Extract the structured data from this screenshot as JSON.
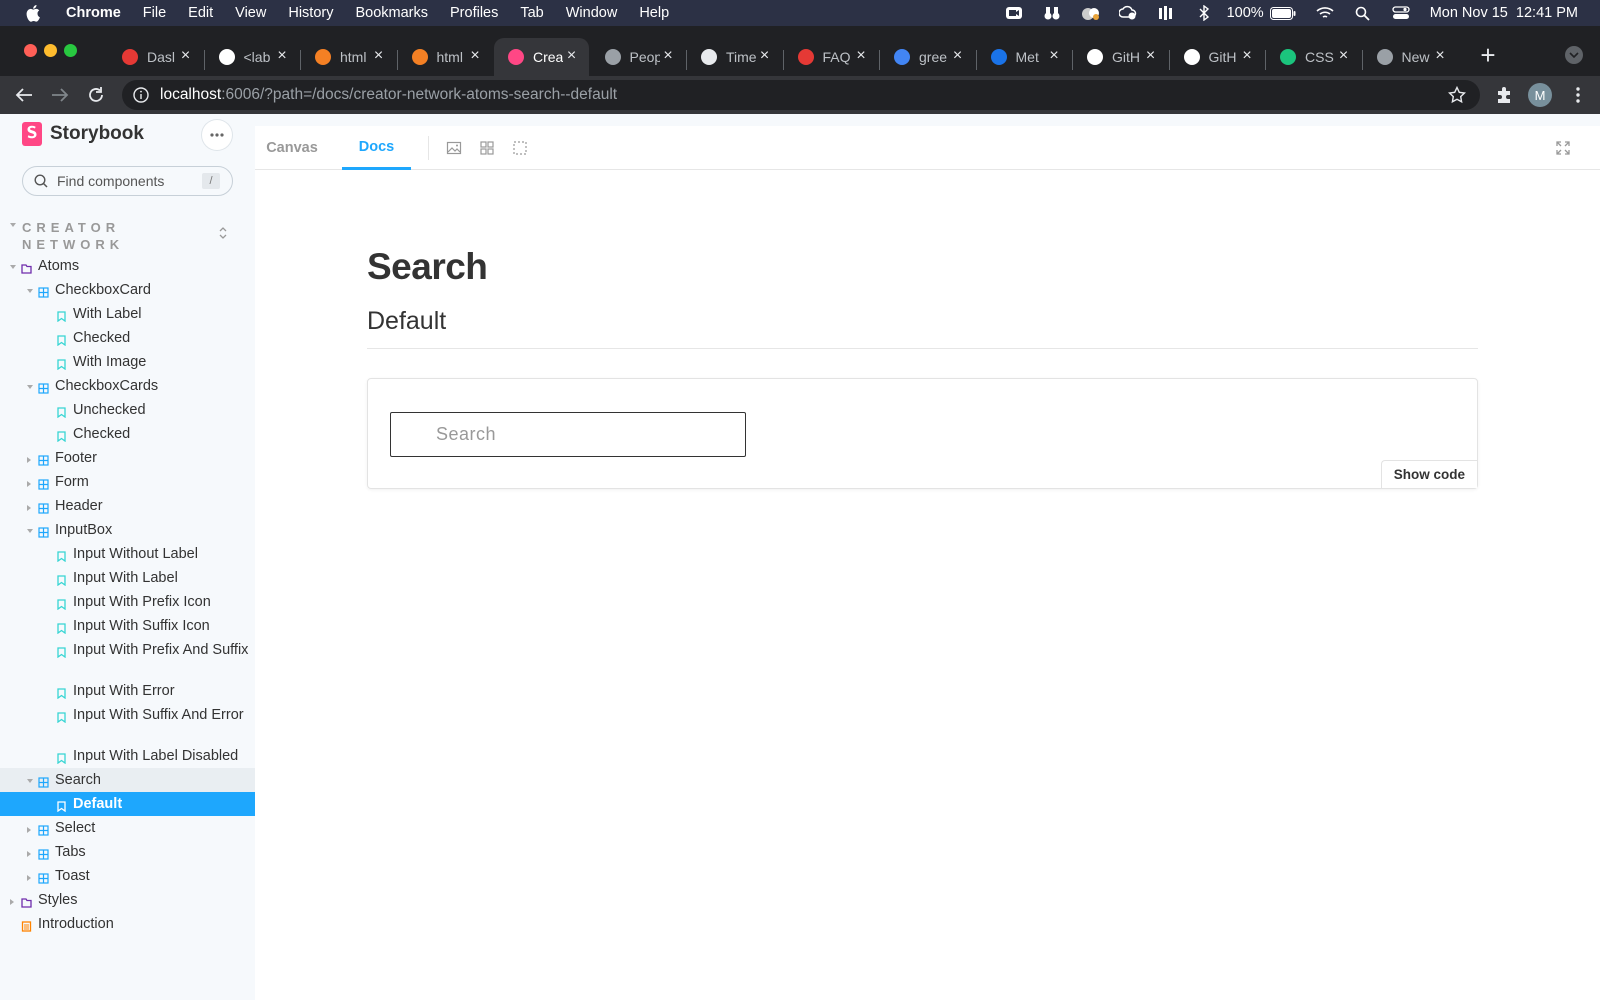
{
  "menubar": {
    "app": "Chrome",
    "items": [
      "File",
      "Edit",
      "View",
      "History",
      "Bookmarks",
      "Profiles",
      "Tab",
      "Window",
      "Help"
    ],
    "battery": "100%",
    "datetime": "Mon Nov 15  12:41 PM"
  },
  "browser": {
    "tabs": [
      {
        "title": "Dasl",
        "favicon_color": "#e53935"
      },
      {
        "title": "<lab",
        "favicon_color": "#ffffff"
      },
      {
        "title": "html",
        "favicon_color": "#f48024"
      },
      {
        "title": "html",
        "favicon_color": "#f48024"
      },
      {
        "title": "Crea",
        "favicon_color": "#ff4785"
      },
      {
        "title": "Peop",
        "favicon_color": "#9aa0a6"
      },
      {
        "title": "Time",
        "favicon_color": "#e8eaed"
      },
      {
        "title": "FAQ",
        "favicon_color": "#e53935"
      },
      {
        "title": "gree",
        "favicon_color": "#4285f4"
      },
      {
        "title": "Met",
        "favicon_color": "#1a73e8"
      },
      {
        "title": "GitH",
        "favicon_color": "#ffffff"
      },
      {
        "title": "GitH",
        "favicon_color": "#ffffff"
      },
      {
        "title": "CSS",
        "favicon_color": "#1bc47d"
      },
      {
        "title": "New",
        "favicon_color": "#9aa0a6"
      }
    ],
    "active_tab_index": 4,
    "url_host": "localhost",
    "url_rest": ":6006/?path=/docs/creator-network-atoms-search--default",
    "avatar_initial": "M"
  },
  "sidebar": {
    "brand": "Storybook",
    "search_placeholder": "Find components",
    "search_shortcut": "/",
    "group": "CREATOR NETWORK",
    "tree": [
      {
        "label": "Atoms",
        "level": 0,
        "kind": "folder",
        "caret": "down"
      },
      {
        "label": "CheckboxCard",
        "level": 1,
        "kind": "component",
        "caret": "down"
      },
      {
        "label": "With Label",
        "level": 2,
        "kind": "story"
      },
      {
        "label": "Checked",
        "level": 2,
        "kind": "story"
      },
      {
        "label": "With Image",
        "level": 2,
        "kind": "story"
      },
      {
        "label": "CheckboxCards",
        "level": 1,
        "kind": "component",
        "caret": "down"
      },
      {
        "label": "Unchecked",
        "level": 2,
        "kind": "story"
      },
      {
        "label": "Checked",
        "level": 2,
        "kind": "story"
      },
      {
        "label": "Footer",
        "level": 1,
        "kind": "component",
        "caret": "right"
      },
      {
        "label": "Form",
        "level": 1,
        "kind": "component",
        "caret": "right"
      },
      {
        "label": "Header",
        "level": 1,
        "kind": "component",
        "caret": "right"
      },
      {
        "label": "InputBox",
        "level": 1,
        "kind": "component",
        "caret": "down"
      },
      {
        "label": "Input Without Label",
        "level": 2,
        "kind": "story"
      },
      {
        "label": "Input With Label",
        "level": 2,
        "kind": "story"
      },
      {
        "label": "Input With Prefix Icon",
        "level": 2,
        "kind": "story"
      },
      {
        "label": "Input With Suffix Icon",
        "level": 2,
        "kind": "story"
      },
      {
        "label": "Input With Prefix And Suffix",
        "level": 2,
        "kind": "story",
        "lines": 2
      },
      {
        "label": "Input With Error",
        "level": 2,
        "kind": "story"
      },
      {
        "label": "Input With Suffix And Error",
        "level": 2,
        "kind": "story",
        "lines": 2
      },
      {
        "label": "Input With Label Disabled",
        "level": 2,
        "kind": "story"
      },
      {
        "label": "Search",
        "level": 1,
        "kind": "component",
        "caret": "down",
        "highlight": true
      },
      {
        "label": "Default",
        "level": 2,
        "kind": "story",
        "selected": true
      },
      {
        "label": "Select",
        "level": 1,
        "kind": "component",
        "caret": "right"
      },
      {
        "label": "Tabs",
        "level": 1,
        "kind": "component",
        "caret": "right"
      },
      {
        "label": "Toast",
        "level": 1,
        "kind": "component",
        "caret": "right"
      },
      {
        "label": "Styles",
        "level": 0,
        "kind": "folder",
        "caret": "right"
      },
      {
        "label": "Introduction",
        "level": 0,
        "kind": "doc"
      }
    ]
  },
  "main": {
    "tabs": [
      "Canvas",
      "Docs"
    ],
    "active_tab": "Docs",
    "title": "Search",
    "subtitle": "Default",
    "story_search_placeholder": "Search",
    "show_code_label": "Show code"
  },
  "colors": {
    "accent": "#1ea7fd",
    "storybook_pink": "#ff4785",
    "component_icon": "#1ea7fd",
    "story_icon": "#37d5d3",
    "folder_icon": "#6f2cac",
    "doc_icon": "#ff8300"
  }
}
